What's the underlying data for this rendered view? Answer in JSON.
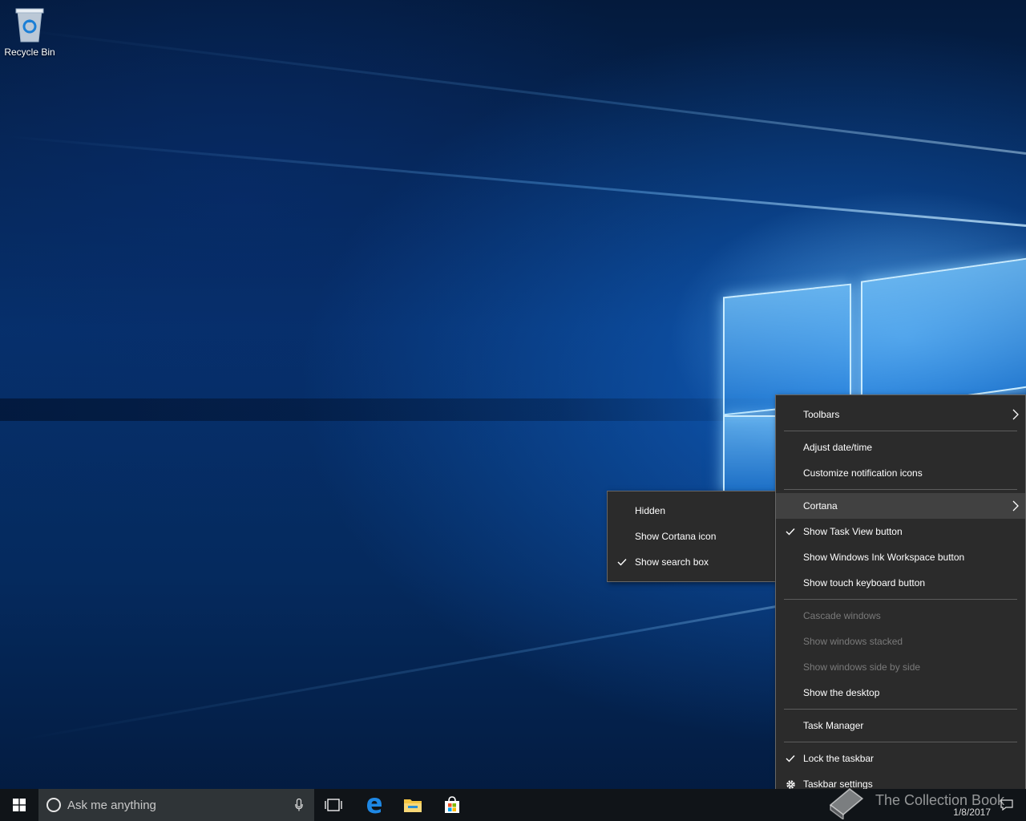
{
  "desktop": {
    "icons": [
      {
        "name": "recycle-bin",
        "label": "Recycle Bin"
      }
    ]
  },
  "taskbar_menu": {
    "items": [
      {
        "label": "Toolbars",
        "submenu": true
      },
      {
        "label": "Adjust date/time"
      },
      {
        "label": "Customize notification icons"
      },
      {
        "label": "Cortana",
        "submenu": true,
        "highlighted": true
      },
      {
        "label": "Show Task View button",
        "checked": true
      },
      {
        "label": "Show Windows Ink Workspace button"
      },
      {
        "label": "Show touch keyboard button"
      },
      {
        "label": "Cascade windows",
        "disabled": true
      },
      {
        "label": "Show windows stacked",
        "disabled": true
      },
      {
        "label": "Show windows side by side",
        "disabled": true
      },
      {
        "label": "Show the desktop"
      },
      {
        "label": "Task Manager"
      },
      {
        "label": "Lock the taskbar",
        "checked": true
      },
      {
        "label": "Taskbar settings",
        "icon": "gear-icon"
      }
    ]
  },
  "cortana_submenu": {
    "items": [
      {
        "label": "Hidden"
      },
      {
        "label": "Show Cortana icon"
      },
      {
        "label": "Show search box",
        "checked": true
      }
    ]
  },
  "taskbar": {
    "search_placeholder": "Ask me anything",
    "pinned": [
      "task-view-icon",
      "edge-icon",
      "file-explorer-icon",
      "store-icon"
    ],
    "date": "1/8/2017"
  },
  "watermark": {
    "text": "The Collection Book"
  },
  "colors": {
    "menu_bg": "#2b2b2b",
    "menu_hover": "#414141",
    "taskbar_bg": "#101418",
    "search_bg": "#2f3437",
    "edge_blue": "#1e88e5",
    "explorer_yellow": "#f4c542"
  }
}
